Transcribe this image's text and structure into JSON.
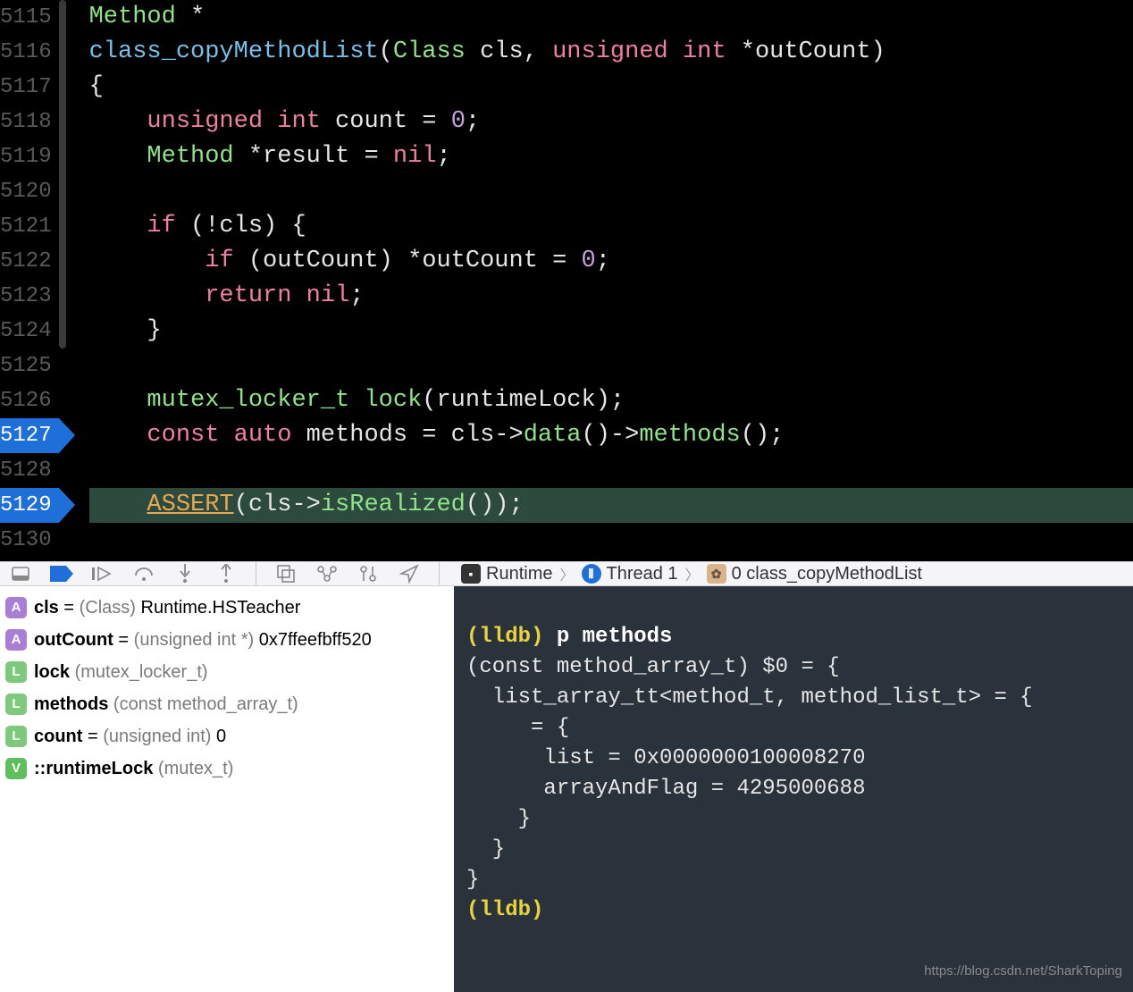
{
  "lines": {
    "start": 5115,
    "breakpoints": [
      5127,
      5129
    ],
    "current": 5129
  },
  "code": {
    "l5115": {
      "indent": "",
      "tokens": [
        [
          "Method",
          "tk-type"
        ],
        [
          " ",
          "tk-punc"
        ],
        [
          "*",
          "tk-op"
        ]
      ]
    },
    "l5116": {
      "indent": "",
      "tokens": [
        [
          "class_copyMethodList",
          "tk-func"
        ],
        [
          "(",
          "tk-punc"
        ],
        [
          "Class",
          "tk-type"
        ],
        [
          " cls, ",
          "tk-id"
        ],
        [
          "unsigned",
          "tk-kw"
        ],
        [
          " ",
          "tk-punc"
        ],
        [
          "int",
          "tk-kw"
        ],
        [
          " *outCount)",
          "tk-id"
        ]
      ]
    },
    "l5117": {
      "indent": "",
      "tokens": [
        [
          "{",
          "tk-punc"
        ]
      ]
    },
    "l5118": {
      "indent": "    ",
      "tokens": [
        [
          "unsigned",
          "tk-kw"
        ],
        [
          " ",
          "tk-punc"
        ],
        [
          "int",
          "tk-kw"
        ],
        [
          " count = ",
          "tk-id"
        ],
        [
          "0",
          "tk-num"
        ],
        [
          ";",
          "tk-punc"
        ]
      ]
    },
    "l5119": {
      "indent": "    ",
      "tokens": [
        [
          "Method",
          "tk-type"
        ],
        [
          " *result = ",
          "tk-id"
        ],
        [
          "nil",
          "tk-const"
        ],
        [
          ";",
          "tk-punc"
        ]
      ]
    },
    "l5120": {
      "indent": "",
      "tokens": []
    },
    "l5121": {
      "indent": "    ",
      "tokens": [
        [
          "if",
          "tk-kw"
        ],
        [
          " (!cls) {",
          "tk-id"
        ]
      ]
    },
    "l5122": {
      "indent": "        ",
      "tokens": [
        [
          "if",
          "tk-kw"
        ],
        [
          " (outCount) *outCount = ",
          "tk-id"
        ],
        [
          "0",
          "tk-num"
        ],
        [
          ";",
          "tk-punc"
        ]
      ]
    },
    "l5123": {
      "indent": "        ",
      "tokens": [
        [
          "return",
          "tk-kw"
        ],
        [
          " ",
          "tk-punc"
        ],
        [
          "nil",
          "tk-const"
        ],
        [
          ";",
          "tk-punc"
        ]
      ]
    },
    "l5124": {
      "indent": "    ",
      "tokens": [
        [
          "}",
          "tk-punc"
        ]
      ]
    },
    "l5125": {
      "indent": "",
      "tokens": []
    },
    "l5126": {
      "indent": "    ",
      "tokens": [
        [
          "mutex_locker_t",
          "tk-type"
        ],
        [
          " ",
          "tk-punc"
        ],
        [
          "lock",
          "tk-call"
        ],
        [
          "(runtimeLock);",
          "tk-id"
        ]
      ]
    },
    "l5127": {
      "indent": "    ",
      "tokens": [
        [
          "const",
          "tk-kw"
        ],
        [
          " ",
          "tk-punc"
        ],
        [
          "auto",
          "tk-kw"
        ],
        [
          " methods = cls->",
          "tk-id"
        ],
        [
          "data",
          "tk-call"
        ],
        [
          "()->",
          "tk-id"
        ],
        [
          "methods",
          "tk-call"
        ],
        [
          "();",
          "tk-id"
        ]
      ]
    },
    "l5128": {
      "indent": "",
      "tokens": []
    },
    "l5129": {
      "indent": "    ",
      "tokens": [
        [
          "ASSERT",
          "tk-macro"
        ],
        [
          "(cls->",
          "tk-id"
        ],
        [
          "isRealized",
          "tk-call"
        ],
        [
          "());",
          "tk-id"
        ]
      ]
    },
    "l5130": {
      "indent": "",
      "tokens": []
    }
  },
  "breadcrumb": {
    "target": "Runtime",
    "thread": "Thread 1",
    "frame": "0 class_copyMethodList"
  },
  "vars": [
    {
      "badge": "A",
      "name": "cls",
      "eq": " = ",
      "type": "(Class) ",
      "val": "Runtime.HSTeacher"
    },
    {
      "badge": "A",
      "name": "outCount",
      "eq": " = ",
      "type": "(unsigned int *) ",
      "val": "0x7ffeefbff520"
    },
    {
      "badge": "L",
      "name": "lock",
      "eq": " ",
      "type": "(mutex_locker_t)",
      "val": ""
    },
    {
      "badge": "L",
      "name": "methods",
      "eq": " ",
      "type": "(const method_array_t)",
      "val": ""
    },
    {
      "badge": "L",
      "name": "count",
      "eq": " = ",
      "type": "(unsigned int) ",
      "val": "0"
    },
    {
      "badge": "V",
      "name": "::runtimeLock",
      "eq": " ",
      "type": "(mutex_t)",
      "val": ""
    }
  ],
  "console": {
    "prompt": "(lldb)",
    "cmd": "p methods",
    "out1": "(const method_array_t) $0 = {",
    "out2": "  list_array_tt<method_t, method_list_t> = {",
    "out3": "     = {",
    "out4": "      list = 0x0000000100008270",
    "out5": "      arrayAndFlag = 4295000688",
    "out6": "    }",
    "out7": "  }",
    "out8": "}"
  },
  "watermark": "https://blog.csdn.net/SharkToping"
}
